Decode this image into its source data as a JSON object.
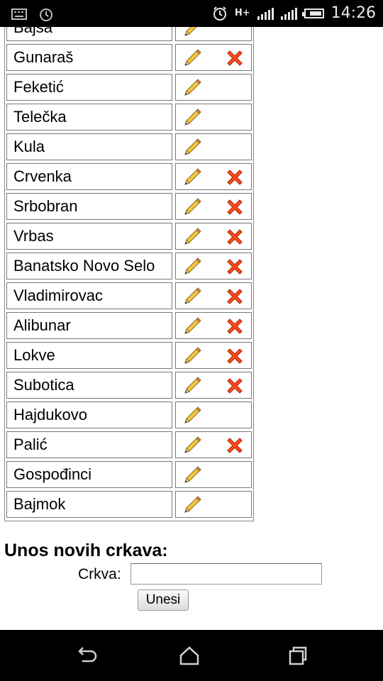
{
  "status_bar": {
    "time": "14:26",
    "network": "H+",
    "icons": [
      "keyboard-icon",
      "clock-icon",
      "alarm-icon",
      "signal-icon",
      "battery-icon"
    ]
  },
  "table": {
    "partial_row": "Bajša",
    "rows": [
      {
        "name": "Gunaraš",
        "deletable": true
      },
      {
        "name": "Feketić",
        "deletable": false
      },
      {
        "name": "Telečka",
        "deletable": false
      },
      {
        "name": "Kula",
        "deletable": false
      },
      {
        "name": "Crvenka",
        "deletable": true
      },
      {
        "name": "Srbobran",
        "deletable": true
      },
      {
        "name": "Vrbas",
        "deletable": true
      },
      {
        "name": "Banatsko Novo Selo",
        "deletable": true
      },
      {
        "name": "Vladimirovac",
        "deletable": true
      },
      {
        "name": "Alibunar",
        "deletable": true
      },
      {
        "name": "Lokve",
        "deletable": true
      },
      {
        "name": "Subotica",
        "deletable": true
      },
      {
        "name": "Hajdukovo",
        "deletable": false
      },
      {
        "name": "Palić",
        "deletable": true
      },
      {
        "name": "Gospođinci",
        "deletable": false
      },
      {
        "name": "Bajmok",
        "deletable": false
      }
    ]
  },
  "form": {
    "title": "Unos novih crkava:",
    "label": "Crkva:",
    "input_value": "",
    "submit_label": "Unesi"
  },
  "colors": {
    "delete_red": "#ff4a1c",
    "pencil_yellow": "#f4c542",
    "status_bar_bg": "#000000"
  }
}
